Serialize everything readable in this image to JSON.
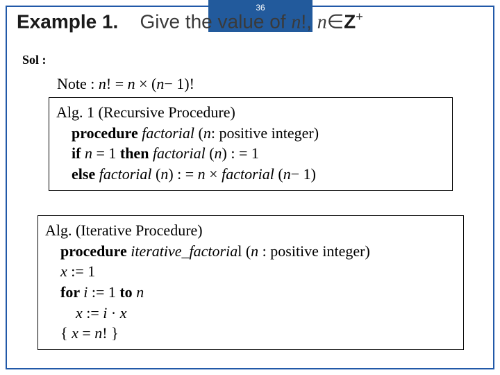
{
  "page_number": "36",
  "title": {
    "label": "Example 1.",
    "text_prefix": "Give the value of ",
    "n_excl": "n",
    "excl": "!, ",
    "n2": "n",
    "in": "∈",
    "set": "Z",
    "sup": "+"
  },
  "sol_label": "Sol :",
  "note": {
    "prefix": "Note : ",
    "n1": "n",
    "mid1": "! = ",
    "n2": "n",
    "times": " × (",
    "n3": "n",
    "minus": "− 1)!"
  },
  "alg1": {
    "heading": "Alg. 1 (Recursive Procedure)",
    "l1_kw": "procedure ",
    "l1_name": "factorial ",
    "l1_open": "(",
    "l1_n": "n",
    "l1_rest": ": positive integer)",
    "l2_if": "if ",
    "l2_n": "n",
    "l2_eq": " = 1 ",
    "l2_then": "then ",
    "l2_fact": "factorial ",
    "l2_open": "(",
    "l2_n2": "n",
    "l2_assign": ") : = 1",
    "l3_else": "else ",
    "l3_fact": "factorial ",
    "l3_open": "(",
    "l3_n": "n",
    "l3_mid": ") : = ",
    "l3_n2": "n",
    "l3_times": " × ",
    "l3_fact2": "factorial ",
    "l3_open2": "(",
    "l3_n3": "n",
    "l3_end": "− 1)"
  },
  "alg2": {
    "heading": "Alg. (Iterative Procedure)",
    "l1_kw": "procedure ",
    "l1_name": "iterative_factoria",
    "l1_l": "l",
    "l1_open": " (",
    "l1_n": "n",
    "l1_rest": " : positive integer)",
    "l2_x": "x",
    "l2_rest": " := 1",
    "l3_for": "for  ",
    "l3_i": "i",
    "l3_mid": " := 1 ",
    "l3_to": "to ",
    "l3_n": "n",
    "l4_x": "x",
    "l4_mid": " := ",
    "l4_i": "i",
    "l4_dot": " · ",
    "l4_x2": "x",
    "l5_open": "{ ",
    "l5_x": "x",
    "l5_eq": " = ",
    "l5_n": "n",
    "l5_end": "! }"
  }
}
